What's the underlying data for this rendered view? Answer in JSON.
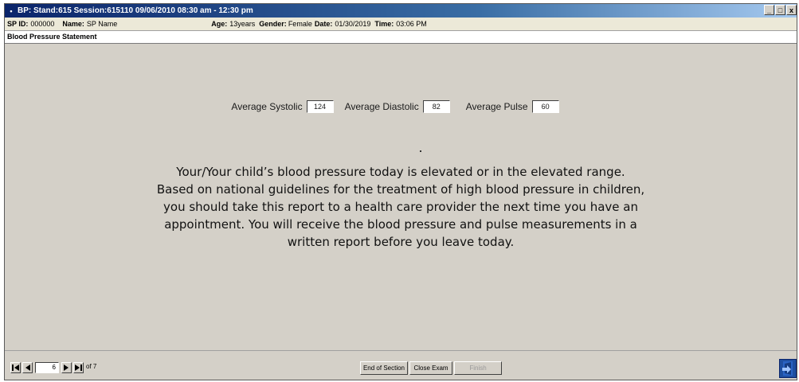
{
  "window": {
    "sys_icon": "•",
    "title": "BP: Stand:615 Session:615110 09/06/2010 08:30 am - 12:30 pm",
    "min_glyph": "_",
    "max_glyph": "□",
    "close_glyph": "x"
  },
  "info": {
    "sp_id_label": "SP ID:",
    "sp_id_value": "000000",
    "name_label": "Name:",
    "name_value": "SP Name",
    "age_label": "Age:",
    "age_value": "13years",
    "gender_label": "Gender:",
    "gender_value": "Female",
    "date_label": "Date:",
    "date_value": "01/30/2019",
    "time_label": "Time:",
    "time_value": "03:06 PM"
  },
  "section": {
    "title": "Blood Pressure Statement"
  },
  "vitals": {
    "systolic_label": "Average Systolic",
    "systolic_value": "124",
    "diastolic_label": "Average Diastolic",
    "diastolic_value": "82",
    "pulse_label": "Average Pulse",
    "pulse_value": "60"
  },
  "statement": {
    "lines": [
      "Your/Your child’s blood pressure today is elevated or in the elevated range.",
      "Based on national guidelines for the treatment of high blood pressure in children,",
      "you should take this report to a health care provider the next time you have an",
      "appointment.  You will receive the blood pressure and pulse measurements in a",
      "written report before you leave today."
    ]
  },
  "footer": {
    "current_page": "6",
    "of_label": "of 7",
    "end_section": "End of Section",
    "close_exam": "Close Exam",
    "finish": "Finish",
    "icons": {
      "first": "first-page-icon",
      "prev": "previous-page-icon",
      "next": "next-page-icon",
      "last": "last-page-icon",
      "exit": "exit-door-icon"
    }
  },
  "colors": {
    "titlebar": "#0a246a",
    "panel": "#d4d0c8",
    "exit_icon": "#1f4fa0"
  }
}
